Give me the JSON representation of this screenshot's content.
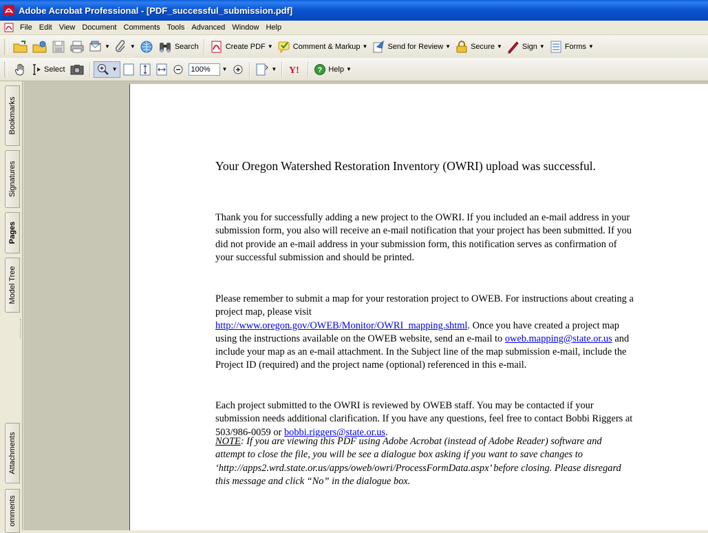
{
  "window": {
    "title": "Adobe Acrobat Professional - [PDF_successful_submission.pdf]"
  },
  "menu": [
    "File",
    "Edit",
    "View",
    "Document",
    "Comments",
    "Tools",
    "Advanced",
    "Window",
    "Help"
  ],
  "toolbar1": {
    "search": "Search",
    "create_pdf": "Create PDF",
    "comment_markup": "Comment & Markup",
    "send_review": "Send for Review",
    "secure": "Secure",
    "sign": "Sign",
    "forms": "Forms"
  },
  "toolbar2": {
    "select": "Select",
    "zoom": "100%",
    "help": "Help"
  },
  "nav_tabs": {
    "bookmarks": "Bookmarks",
    "signatures": "Signatures",
    "pages": "Pages",
    "model_tree": "Model Tree",
    "attachments": "Attachments",
    "comments": "omments"
  },
  "document": {
    "heading": "Your Oregon Watershed Restoration Inventory (OWRI) upload was successful.",
    "para1": "Thank you for successfully adding a new project to the OWRI.  If you included an e-mail address in your submission form, you also will receive an e-mail notification that your project has been submitted.  If you did not provide an e-mail address in your submission form, this notification serves as confirmation of your successful submission and should be printed.",
    "para2_a": "Please remember to submit a map for your restoration project to OWEB.  For instructions about creating a project map, please visit",
    "para2_link": "http://www.oregon.gov/OWEB/Monitor/OWRI_mapping.shtml",
    "para2_b": ".  Once you have created a project map using the instructions available on the OWEB website, send an e-mail to",
    "para2_email": "oweb.mapping@state.or.us",
    "para2_c": " and include your map as an e-mail attachment.  In the Subject line of the map submission e-mail, include the Project ID (required) and the project name (optional) referenced in this e-mail.",
    "para3_a": "Each project submitted to the OWRI is reviewed by OWEB staff.  You may be contacted if your submission needs additional clarification.  If you have any questions, feel free to contact Bobbi Riggers at 503/986-0059 or ",
    "para3_email": "bobbi.riggers@state.or.us",
    "para3_b": ".",
    "note_label": "NOTE",
    "note_text": ":  If you are viewing this PDF using Adobe Acrobat (instead of Adobe Reader) software and attempt to close the file, you will be see a dialogue box asking if you want to save changes to ‘http://apps2.wrd.state.or.us/apps/oweb/owri/ProcessFormData.aspx’ before closing.  Please disregard this message and click “No” in the dialogue box."
  },
  "colors": {
    "titlebar": "#0b56d4",
    "workspace": "#c7c6b5",
    "link": "#0000ee"
  }
}
